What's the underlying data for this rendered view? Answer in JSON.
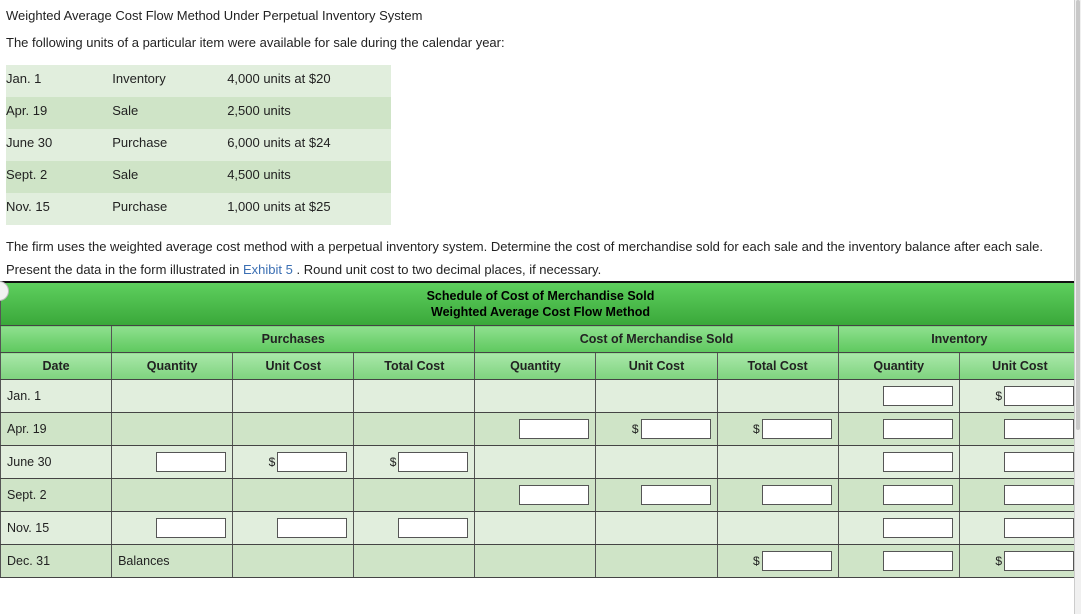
{
  "title": "Weighted Average Cost Flow Method Under Perpetual Inventory System",
  "lead": "The following units of a particular item were available for sale during the calendar year:",
  "transactions": [
    {
      "date": "Jan. 1",
      "type": "Inventory",
      "detail": "4,000 units at $20"
    },
    {
      "date": "Apr. 19",
      "type": "Sale",
      "detail": "2,500 units"
    },
    {
      "date": "June 30",
      "type": "Purchase",
      "detail": "6,000 units at $24"
    },
    {
      "date": "Sept. 2",
      "type": "Sale",
      "detail": "4,500 units"
    },
    {
      "date": "Nov. 15",
      "type": "Purchase",
      "detail": "1,000 units at $25"
    }
  ],
  "instr": {
    "part1": "The firm uses the weighted average cost method with a perpetual inventory system. Determine the cost of merchandise sold for each sale and the inventory balance after each sale. Present the data in the form illustrated in ",
    "link": "Exhibit 5",
    "part2": ". Round unit cost to two decimal places, if necessary."
  },
  "schedule": {
    "title1": "Schedule of Cost of Merchandise Sold",
    "title2": "Weighted Average Cost Flow Method",
    "groups": {
      "purchases": "Purchases",
      "cogs": "Cost of Merchandise Sold",
      "inventory": "Inventory"
    },
    "cols": {
      "date": "Date",
      "p_qty": "Quantity",
      "p_uc": "Unit Cost",
      "p_tc": "Total Cost",
      "c_qty": "Quantity",
      "c_uc": "Unit Cost",
      "c_tc": "Total Cost",
      "i_qty": "Quantity",
      "i_uc": "Unit Cost"
    },
    "rows": [
      {
        "date": "Jan. 1",
        "cells": {
          "p_qty": null,
          "p_uc": null,
          "p_tc": null,
          "c_qty": null,
          "c_uc": null,
          "c_tc": null,
          "i_qty": {
            "prefix": ""
          },
          "i_uc": {
            "prefix": "$"
          }
        }
      },
      {
        "date": "Apr. 19",
        "cells": {
          "p_qty": null,
          "p_uc": null,
          "p_tc": null,
          "c_qty": {
            "prefix": ""
          },
          "c_uc": {
            "prefix": "$"
          },
          "c_tc": {
            "prefix": "$"
          },
          "i_qty": {
            "prefix": ""
          },
          "i_uc": {
            "prefix": ""
          }
        }
      },
      {
        "date": "June 30",
        "cells": {
          "p_qty": {
            "prefix": ""
          },
          "p_uc": {
            "prefix": "$"
          },
          "p_tc": {
            "prefix": "$"
          },
          "c_qty": null,
          "c_uc": null,
          "c_tc": null,
          "i_qty": {
            "prefix": ""
          },
          "i_uc": {
            "prefix": ""
          }
        }
      },
      {
        "date": "Sept. 2",
        "cells": {
          "p_qty": null,
          "p_uc": null,
          "p_tc": null,
          "c_qty": {
            "prefix": ""
          },
          "c_uc": {
            "prefix": ""
          },
          "c_tc": {
            "prefix": ""
          },
          "i_qty": {
            "prefix": ""
          },
          "i_uc": {
            "prefix": ""
          }
        }
      },
      {
        "date": "Nov. 15",
        "cells": {
          "p_qty": {
            "prefix": ""
          },
          "p_uc": {
            "prefix": ""
          },
          "p_tc": {
            "prefix": ""
          },
          "c_qty": null,
          "c_uc": null,
          "c_tc": null,
          "i_qty": {
            "prefix": ""
          },
          "i_uc": {
            "prefix": ""
          }
        }
      },
      {
        "date": "Dec. 31",
        "label": "Balances",
        "cells": {
          "p_qty": null,
          "p_uc": null,
          "p_tc": null,
          "c_qty": null,
          "c_uc": null,
          "c_tc": {
            "prefix": "$"
          },
          "i_qty": {
            "prefix": ""
          },
          "i_uc": {
            "prefix": "$"
          }
        }
      }
    ]
  }
}
